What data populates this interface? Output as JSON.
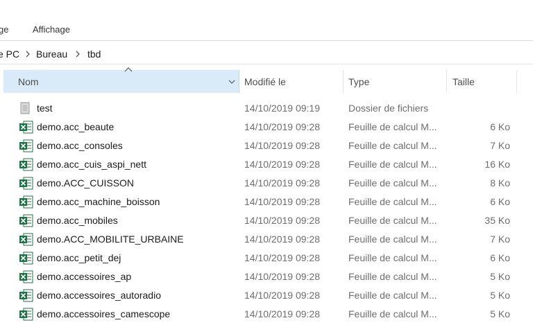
{
  "ribbon": {
    "tabs": [
      "ge",
      "Affichage"
    ]
  },
  "breadcrumb": [
    "e PC",
    "Bureau",
    "tbd"
  ],
  "columns": {
    "name": "Nom",
    "modified": "Modifié le",
    "type": "Type",
    "size": "Taille"
  },
  "files": [
    {
      "name": "test",
      "modified": "14/10/2019 09:19",
      "type": "Dossier de fichiers",
      "size": "",
      "icon": "folder-icon"
    },
    {
      "name": "demo.acc_beaute",
      "modified": "14/10/2019 09:28",
      "type": "Feuille de calcul M...",
      "size": "6 Ko",
      "icon": "excel-icon"
    },
    {
      "name": "demo.acc_consoles",
      "modified": "14/10/2019 09:28",
      "type": "Feuille de calcul M...",
      "size": "7 Ko",
      "icon": "excel-icon"
    },
    {
      "name": "demo.acc_cuis_aspi_nett",
      "modified": "14/10/2019 09:28",
      "type": "Feuille de calcul M...",
      "size": "16 Ko",
      "icon": "excel-icon"
    },
    {
      "name": "demo.ACC_CUISSON",
      "modified": "14/10/2019 09:28",
      "type": "Feuille de calcul M...",
      "size": "8 Ko",
      "icon": "excel-icon"
    },
    {
      "name": "demo.acc_machine_boisson",
      "modified": "14/10/2019 09:28",
      "type": "Feuille de calcul M...",
      "size": "6 Ko",
      "icon": "excel-icon"
    },
    {
      "name": "demo.acc_mobiles",
      "modified": "14/10/2019 09:28",
      "type": "Feuille de calcul M...",
      "size": "35 Ko",
      "icon": "excel-icon"
    },
    {
      "name": "demo.ACC_MOBILITE_URBAINE",
      "modified": "14/10/2019 09:28",
      "type": "Feuille de calcul M...",
      "size": "7 Ko",
      "icon": "excel-icon"
    },
    {
      "name": "demo.acc_petit_dej",
      "modified": "14/10/2019 09:28",
      "type": "Feuille de calcul M...",
      "size": "6 Ko",
      "icon": "excel-icon"
    },
    {
      "name": "demo.accessoires_ap",
      "modified": "14/10/2019 09:28",
      "type": "Feuille de calcul M...",
      "size": "5 Ko",
      "icon": "excel-icon"
    },
    {
      "name": "demo.accessoires_autoradio",
      "modified": "14/10/2019 09:28",
      "type": "Feuille de calcul M...",
      "size": "5 Ko",
      "icon": "excel-icon"
    },
    {
      "name": "demo.accessoires_camescope",
      "modified": "14/10/2019 09:28",
      "type": "Feuille de calcul M...",
      "size": "5 Ko",
      "icon": "excel-icon"
    }
  ],
  "colors": {
    "header_selected": "#d9ebf9",
    "excel_green": "#1e7145",
    "text_secondary": "#6d6d6d"
  }
}
